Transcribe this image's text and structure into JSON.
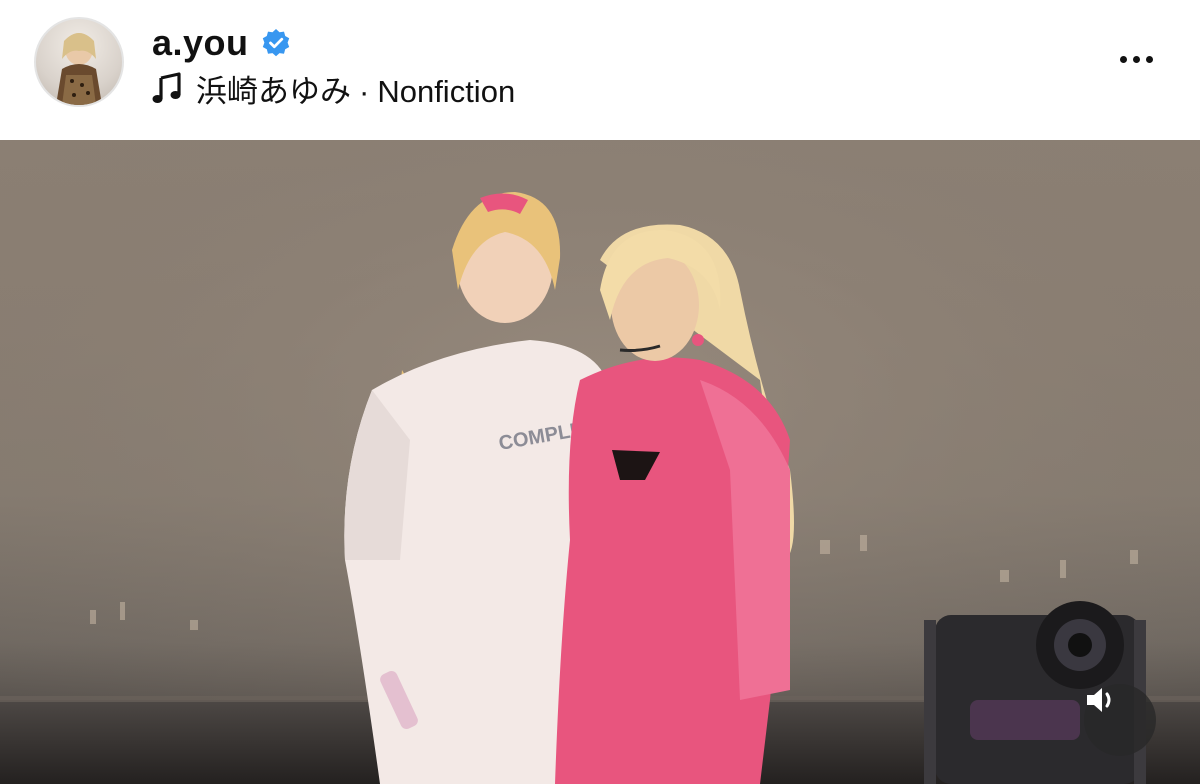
{
  "post": {
    "username": "a.you",
    "verified": true,
    "music": {
      "artist": "浜崎あゆみ",
      "separator": "·",
      "song": "Nonfiction"
    }
  },
  "icons": {
    "verified": "verified-badge-icon",
    "music": "music-note-icon",
    "more": "more-horizontal-icon",
    "sound": "speaker-volume-icon"
  },
  "colors": {
    "verified": "#3897f0",
    "pink_dress": "#e8557e",
    "hoodie": "#f3e9e6"
  }
}
